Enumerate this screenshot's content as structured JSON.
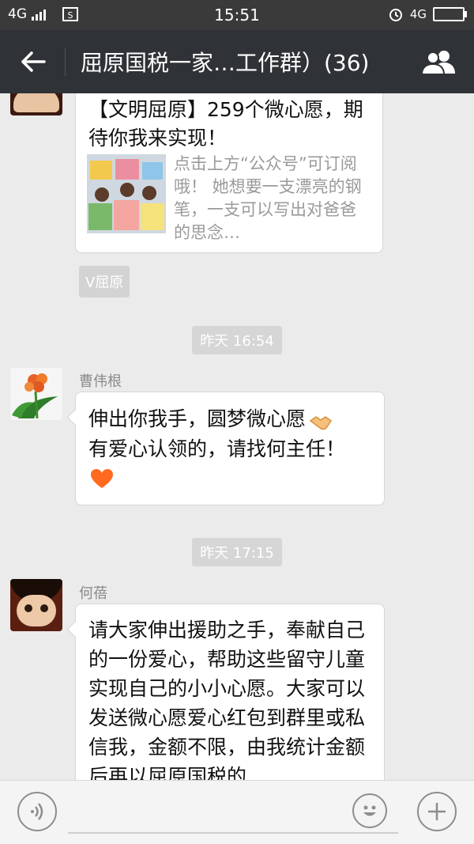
{
  "status_bar": {
    "network_left": "4G",
    "time": "15:51",
    "network_right": "4G"
  },
  "title_bar": {
    "title": "屈原国税一家…工作群）(36)"
  },
  "messages": {
    "m1": {
      "article_title": "【文明屈原】259个微心愿，期待你我来实现！",
      "article_desc": "点击上方“公众号”可订阅哦！ 她想要一支漂亮的钢笔，一支可以写出对爸爸的思念…",
      "source_tag": "V屈原"
    },
    "ts1": "昨天 16:54",
    "m2": {
      "sender": "曹伟根",
      "line1": "伸出你我手，圆梦微心愿",
      "line2": "有爱心认领的，请找何主任！"
    },
    "ts2": "昨天 17:15",
    "m3": {
      "sender": "何蓓",
      "text": "请大家伸出援助之手，奉献自己的一份爱心，帮助这些留守儿童实现自己的小小心愿。大家可以发送微心愿爱心红包到群里或私信我，金额不限，由我统计金额后再以屈原国税的"
    }
  },
  "icons": {
    "back": "arrow-left-icon",
    "group": "group-members-icon",
    "voice": "voice-icon",
    "emoji": "emoji-icon",
    "plus": "plus-icon",
    "handshake": "handshake-emoji",
    "heart": "orange-heart-emoji"
  },
  "colors": {
    "title_bar": "#2f3236",
    "background": "#ebebeb",
    "heart": "#ff6a1f"
  }
}
